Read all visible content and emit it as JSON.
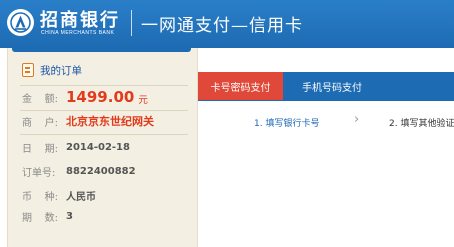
{
  "header": {
    "bank_name_cn": "招商银行",
    "bank_name_en": "CHINA MERCHANTS BANK",
    "slogan": "一网通支付—信用卡",
    "brand_color": "#1d6bb3"
  },
  "order": {
    "title": "我的订单",
    "amount_label": [
      "金",
      "额:"
    ],
    "amount_value": "1499.00",
    "amount_unit": "元",
    "merchant_label": [
      "商",
      "户:"
    ],
    "merchant_value": "北京京东世纪网关",
    "date_label": [
      "日",
      "期:"
    ],
    "date_value": "2014-02-18",
    "order_no_label": [
      "订单号:"
    ],
    "order_no_value": "8822400882",
    "currency_label": [
      "币",
      "种:"
    ],
    "currency_value": "人民币",
    "installments_label": [
      "期",
      "数:"
    ],
    "installments_value": "3",
    "accent_color": "#e33a1b"
  },
  "payment": {
    "tabs": [
      {
        "label": "卡号密码支付",
        "active": true
      },
      {
        "label": "手机号码支付",
        "active": false
      }
    ],
    "steps": [
      {
        "label": "1. 填写银行卡号"
      },
      {
        "label": "2. 填写其他验证"
      }
    ],
    "active_tab_color": "#e0493a"
  }
}
